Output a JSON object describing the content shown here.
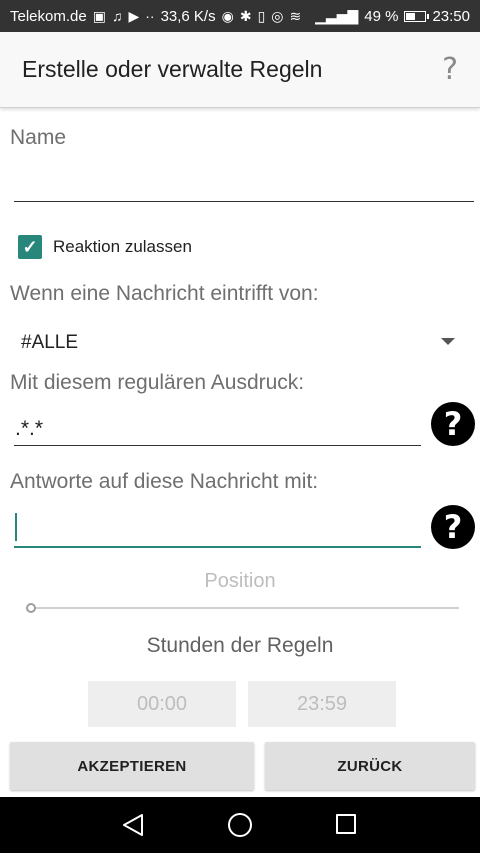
{
  "status_bar": {
    "carrier": "Telekom.de",
    "speed": "33,6 K/s",
    "battery": "49 %",
    "battery_level": 0.49,
    "time": "23:50"
  },
  "app_bar": {
    "title": "Erstelle oder verwalte Regeln"
  },
  "form": {
    "name_label": "Name",
    "name_value": "",
    "allow_reaction_label": "Reaktion zulassen",
    "allow_reaction_checked": true,
    "sender_label": "Wenn eine Nachricht eintrifft von:",
    "sender_value": "#ALLE",
    "regex_label": "Mit diesem regulären Ausdruck:",
    "regex_value": ".*.*",
    "reply_label": "Antworte auf diese Nachricht mit:",
    "reply_value": "",
    "position_label": "Position",
    "position_value": 0,
    "hours_label": "Stunden der Regeln",
    "start_time": "00:00",
    "end_time": "23:59"
  },
  "buttons": {
    "accept": "AKZEPTIEREN",
    "back": "ZURÜCK"
  },
  "colors": {
    "accent": "#26877a"
  }
}
